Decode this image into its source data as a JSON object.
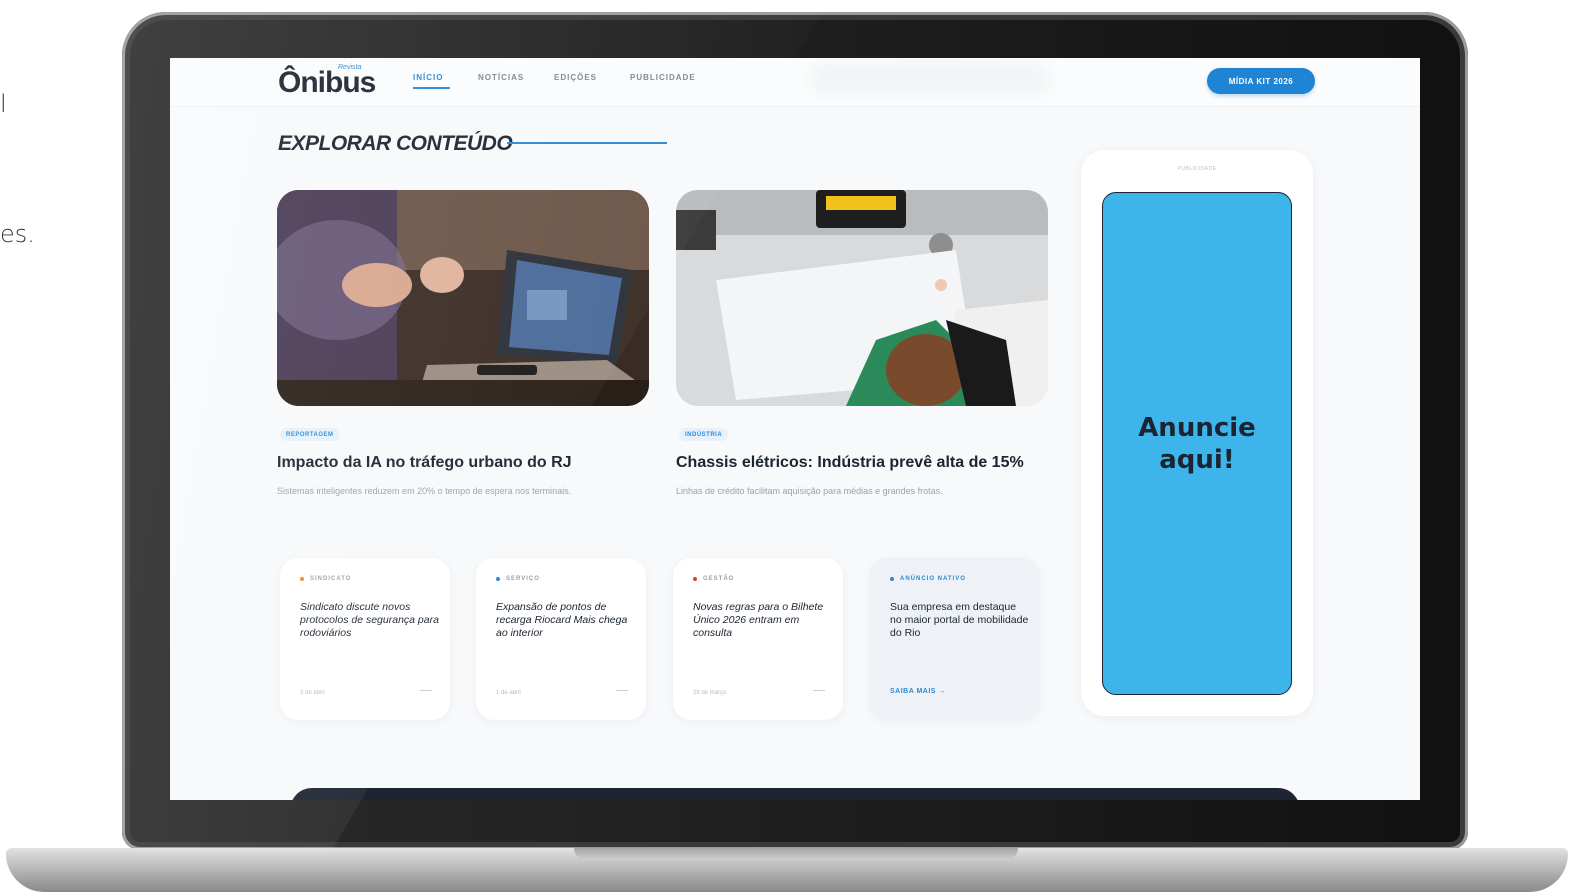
{
  "background_text": [
    "l",
    "es."
  ],
  "header": {
    "logo": "Ônibus",
    "logo_sub": "Revista",
    "nav": [
      "INÍCIO",
      "NOTÍCIAS",
      "EDIÇÕES",
      "PUBLICIDADE"
    ],
    "media_kit": "MÍDIA KIT 2026"
  },
  "section_title": "EXPLORAR CONTEÚDO",
  "features": [
    {
      "tag": "REPORTAGEM",
      "title": "Impacto da IA no tráfego urbano do RJ",
      "desc": "Sistemas inteligentes reduzem em 20% o tempo de espera nos terminais."
    },
    {
      "tag": "INDÚSTRIA",
      "title": "Chassis elétricos: Indústria prevê alta de 15%",
      "desc": "Linhas de crédito facilitam aquisição para médias e grandes frotas."
    }
  ],
  "cards": [
    {
      "category": "SINDICATO",
      "dot_color": "#f08a24",
      "title": "Sindicato discute novos protocolos de segurança para rodoviários",
      "date": "3 de abril"
    },
    {
      "category": "SERVIÇO",
      "dot_color": "#2a8ad6",
      "title": "Expansão de pontos de recarga Riocard Mais chega ao interior",
      "date": "1 de abril"
    },
    {
      "category": "GESTÃO",
      "dot_color": "#e23b3b",
      "title": "Novas regras para o Bilhete Único 2026 entram em consulta",
      "date": "28 de março"
    },
    {
      "category": "ANÚNCIO NATIVO",
      "dot_color": "#2a8ad6",
      "title": "Sua empresa em destaque no maior portal de mobilidade do Rio",
      "link": "SAIBA MAIS →"
    }
  ],
  "ad": {
    "label": "PUBLICIDADE",
    "text_line1": "Anuncie",
    "text_line2": "aqui!"
  }
}
